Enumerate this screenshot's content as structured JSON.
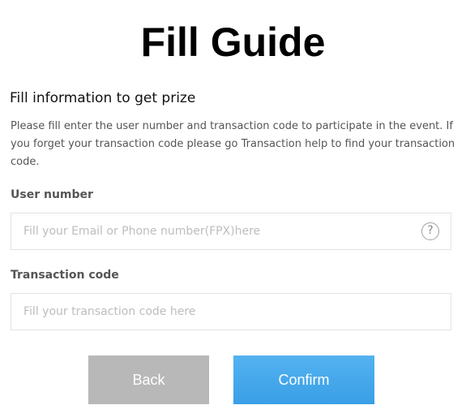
{
  "header": {
    "title": "Fill Guide"
  },
  "form": {
    "heading": "Fill information to get prize",
    "description": "Please fill enter the user number and transaction code to participate in the event. If you forget your transaction code please go Transaction help to find your transaction code.",
    "user_number": {
      "label": "User number",
      "value": "",
      "placeholder": "Fill your Email or Phone number(FPX)here",
      "help_icon": "?"
    },
    "transaction_code": {
      "label": "Transaction code",
      "value": "",
      "placeholder": "Fill your transaction code here"
    }
  },
  "actions": {
    "back_label": "Back",
    "confirm_label": "Confirm"
  },
  "icons": {
    "help": "question-circle-icon"
  },
  "colors": {
    "confirm_button": "#44a8ee",
    "back_button": "#b8b8b8",
    "title_text": "#000000",
    "label_text": "#555555",
    "placeholder_text": "#bdbdbd",
    "field_border": "#e3e3e3"
  }
}
